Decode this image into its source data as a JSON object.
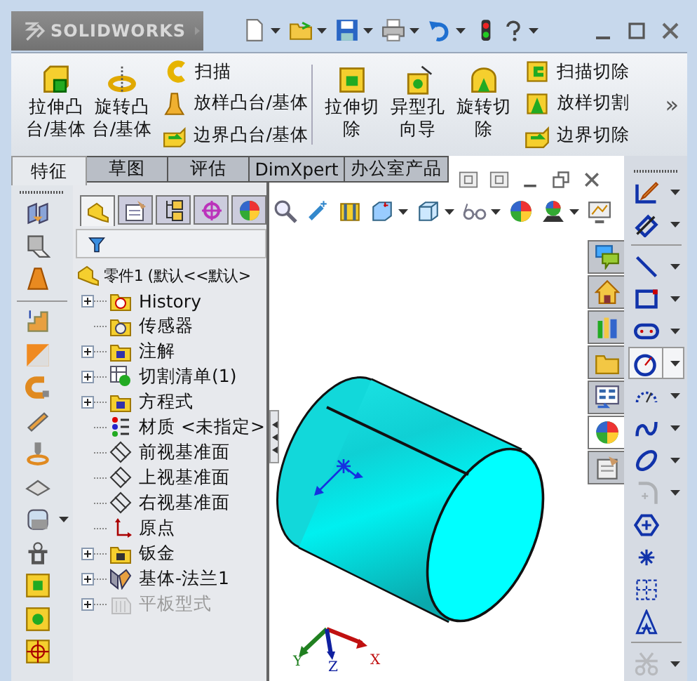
{
  "app_logo": {
    "text": "SOLIDWORKS"
  },
  "ribbon": {
    "groups": [
      {
        "large": [
          "拉伸凸台/基体",
          "旋转凸台/基体"
        ],
        "small": [
          "扫描",
          "放样凸台/基体",
          "边界凸台/基体"
        ]
      },
      {
        "large": [
          "拉伸切除",
          "异型孔向导",
          "旋转切除"
        ],
        "small": [
          "扫描切除",
          "放样切割",
          "边界切除"
        ]
      }
    ],
    "overflow": "»"
  },
  "tabs": [
    {
      "label": "特征",
      "selected": true
    },
    {
      "label": "草图",
      "selected": false
    },
    {
      "label": "评估",
      "selected": false
    },
    {
      "label": "DimXpert",
      "selected": false
    },
    {
      "label": "办公室产品",
      "selected": false
    }
  ],
  "manager_tabs": [
    {
      "selected": true
    },
    {
      "selected": false
    },
    {
      "selected": false
    },
    {
      "selected": false
    },
    {
      "selected": false
    }
  ],
  "feature_tree": {
    "label": "零件1  (默认<<默认>",
    "children": [
      {
        "label": "History",
        "expandable": true,
        "disabled": false
      },
      {
        "label": "传感器",
        "expandable": false,
        "disabled": false
      },
      {
        "label": "注解",
        "expandable": true,
        "disabled": false
      },
      {
        "label": "切割清单(1)",
        "expandable": true,
        "disabled": false
      },
      {
        "label": "方程式",
        "expandable": true,
        "disabled": false
      },
      {
        "label": "材质 <未指定>",
        "expandable": false,
        "disabled": false
      },
      {
        "label": "前视基准面",
        "expandable": false,
        "disabled": false
      },
      {
        "label": "上视基准面",
        "expandable": false,
        "disabled": false
      },
      {
        "label": "右视基准面",
        "expandable": false,
        "disabled": false
      },
      {
        "label": "原点",
        "expandable": false,
        "disabled": false
      },
      {
        "label": "钣金",
        "expandable": true,
        "disabled": false
      },
      {
        "label": "基体-法兰1",
        "expandable": true,
        "disabled": false
      },
      {
        "label": "平板型式",
        "expandable": true,
        "disabled": true
      }
    ]
  },
  "triad": {
    "x_label": "X",
    "y_label": "Y",
    "z_label": "Z"
  },
  "task_pane_tabs": [
    {
      "selected": false
    },
    {
      "selected": false
    },
    {
      "selected": false
    },
    {
      "selected": false
    },
    {
      "selected": false
    },
    {
      "selected": true
    },
    {
      "selected": false
    }
  ],
  "sketch_tools": [
    {
      "selected": false,
      "disabled": false
    },
    {
      "selected": false,
      "disabled": false
    },
    {
      "selected": false,
      "disabled": false
    },
    {
      "selected": false,
      "disabled": false
    },
    {
      "selected": false,
      "disabled": false
    },
    {
      "selected": true,
      "disabled": false
    },
    {
      "selected": false,
      "disabled": false
    },
    {
      "selected": false,
      "disabled": false
    },
    {
      "selected": false,
      "disabled": false
    },
    {
      "selected": false,
      "disabled": true
    },
    {
      "selected": false,
      "disabled": false
    },
    {
      "selected": false,
      "disabled": false
    },
    {
      "selected": false,
      "disabled": false
    },
    {
      "selected": false,
      "disabled": false
    },
    {
      "selected": false,
      "disabled": true
    }
  ]
}
